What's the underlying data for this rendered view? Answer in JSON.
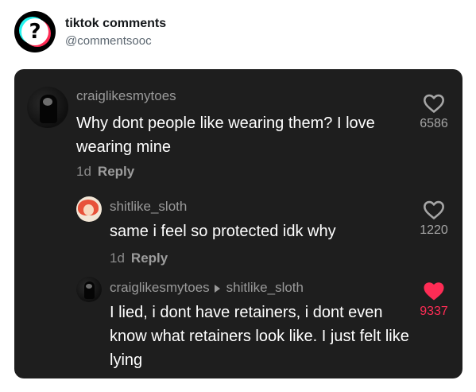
{
  "header": {
    "name": "tiktok comments",
    "handle": "@commentsooc"
  },
  "comments": [
    {
      "username": "craiglikesmytoes",
      "text": "Why dont people like wearing them? I love wearing mine",
      "age": "1d",
      "reply_label": "Reply",
      "likes": "6586",
      "liked": false
    },
    {
      "username": "shitlike_sloth",
      "text": "same i feel so protected idk why",
      "age": "1d",
      "reply_label": "Reply",
      "likes": "1220",
      "liked": false
    },
    {
      "username": "craiglikesmytoes",
      "reply_to": "shitlike_sloth",
      "text": "I lied, i dont have retainers, i dont even know what retainers look like. I just felt like lying",
      "likes": "9337",
      "liked": true
    }
  ],
  "colors": {
    "card_bg": "#1e1e1e",
    "liked": "#fe2c55",
    "text": "#ffffff",
    "muted": "#9a9a9a"
  }
}
